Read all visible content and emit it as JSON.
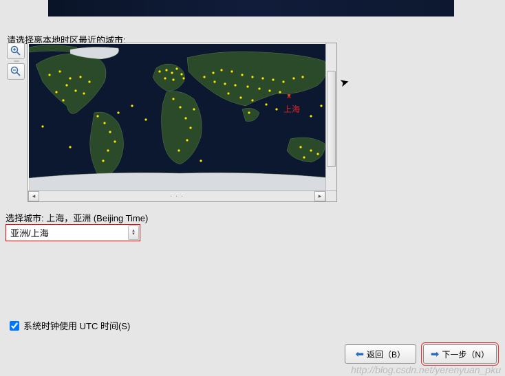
{
  "prompt_label": "请选择离本地时区最近的城市:",
  "map": {
    "highlighted_city": "上海",
    "highlighted_marker": "x"
  },
  "selected_city_label": "选择城市: 上海，亚洲 (Beijing Time)",
  "timezone_combo": {
    "value": "亚洲/上海"
  },
  "utc_checkbox": {
    "checked": true,
    "label": "系统时钟使用 UTC 时间(S)"
  },
  "buttons": {
    "back": "返回（B）",
    "next": "下一步（N）"
  },
  "watermark": "http://blog.csdn.net/yerenyuan_pku"
}
